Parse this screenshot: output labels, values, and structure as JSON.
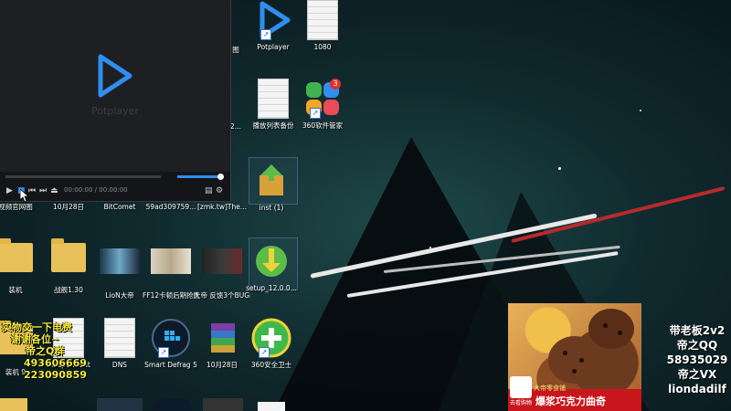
{
  "player": {
    "name": "Potplayer",
    "time": "00:00:00 / 00:00:00"
  },
  "desktop": {
    "icons": [
      {
        "label": "Potplayer"
      },
      {
        "label": "1080"
      },
      {
        "label": "播放列表备份"
      },
      {
        "label": "360软件管家",
        "badge": "3"
      },
      {
        "label": "视频官网图"
      },
      {
        "label": "10月28日"
      },
      {
        "label": "BitComet"
      },
      {
        "label": "59ad309759..."
      },
      {
        "label": "[zmk.tw]The..."
      },
      {
        "label": "inst (1)"
      },
      {
        "label": "装机"
      },
      {
        "label": "战舰1.30"
      },
      {
        "label": "LioN大帝"
      },
      {
        "label": "FF12卡顿后期抢图 (1)"
      },
      {
        "label": "大帝 反馈3个BUG问题"
      },
      {
        "label": "setup_12.0.0..."
      },
      {
        "label": "装机 9"
      },
      {
        "label": "Independent"
      },
      {
        "label": "DNS"
      },
      {
        "label": "Smart Defrag 5"
      },
      {
        "label": "10月28日"
      },
      {
        "label": "360安全卫士"
      },
      {
        "label": "图"
      },
      {
        "label": "2..."
      }
    ]
  },
  "overlay_left": {
    "line1": "实物交一下电费",
    "line2": "谢谢各位~",
    "line3": "帝之Q群",
    "line4": "493606669",
    "line5": "223090859"
  },
  "overlay_right": {
    "line1": "带老板2v2",
    "line2": "帝之QQ",
    "line3": "58935029",
    "line4": "帝之VX",
    "line5": "liondadilf"
  },
  "ad": {
    "brand": "大帝零食铺",
    "title": "爆浆巧克力曲奇",
    "badge": "去看购物"
  }
}
